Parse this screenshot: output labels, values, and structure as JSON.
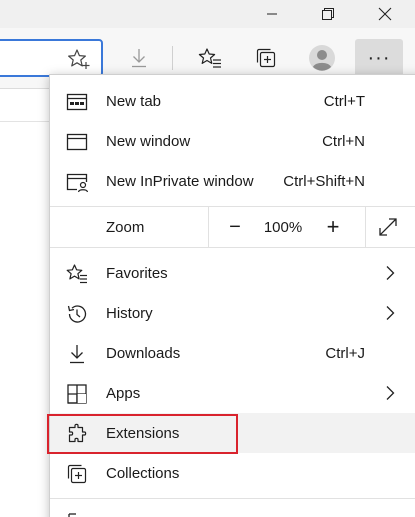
{
  "window": {
    "controls": [
      "minimize-icon",
      "restore-icon",
      "close-icon"
    ]
  },
  "toolbar": {
    "icons": [
      "favorite-star-icon",
      "download-icon",
      "favorites-icon",
      "collections-icon",
      "profile-avatar-icon",
      "settings-more-icon"
    ],
    "more_label": "···"
  },
  "menu": {
    "items_top": [
      {
        "label": "New tab",
        "shortcut": "Ctrl+T",
        "icon": "new-tab-icon"
      },
      {
        "label": "New window",
        "shortcut": "Ctrl+N",
        "icon": "new-window-icon"
      },
      {
        "label": "New InPrivate window",
        "shortcut": "Ctrl+Shift+N",
        "icon": "inprivate-icon"
      }
    ],
    "zoom": {
      "label": "Zoom",
      "value": "100%",
      "minus": "−",
      "plus": "+",
      "icon": "fullscreen-icon"
    },
    "items_bottom": [
      {
        "label": "Favorites",
        "shortcut": "",
        "icon": "favorites-icon",
        "submenu": true
      },
      {
        "label": "History",
        "shortcut": "",
        "icon": "history-icon",
        "submenu": true
      },
      {
        "label": "Downloads",
        "shortcut": "Ctrl+J",
        "icon": "download-icon",
        "submenu": false
      },
      {
        "label": "Apps",
        "shortcut": "",
        "icon": "apps-icon",
        "submenu": true
      },
      {
        "label": "Extensions",
        "shortcut": "",
        "icon": "extensions-icon",
        "submenu": false,
        "highlighted": true
      },
      {
        "label": "Collections",
        "shortcut": "",
        "icon": "collections-icon",
        "submenu": false
      }
    ]
  },
  "colors": {
    "accent_border": "#3a78d9",
    "highlight_box": "#d9232d",
    "menu_background": "#ffffff",
    "toolbar_background": "#f7f7f7"
  }
}
